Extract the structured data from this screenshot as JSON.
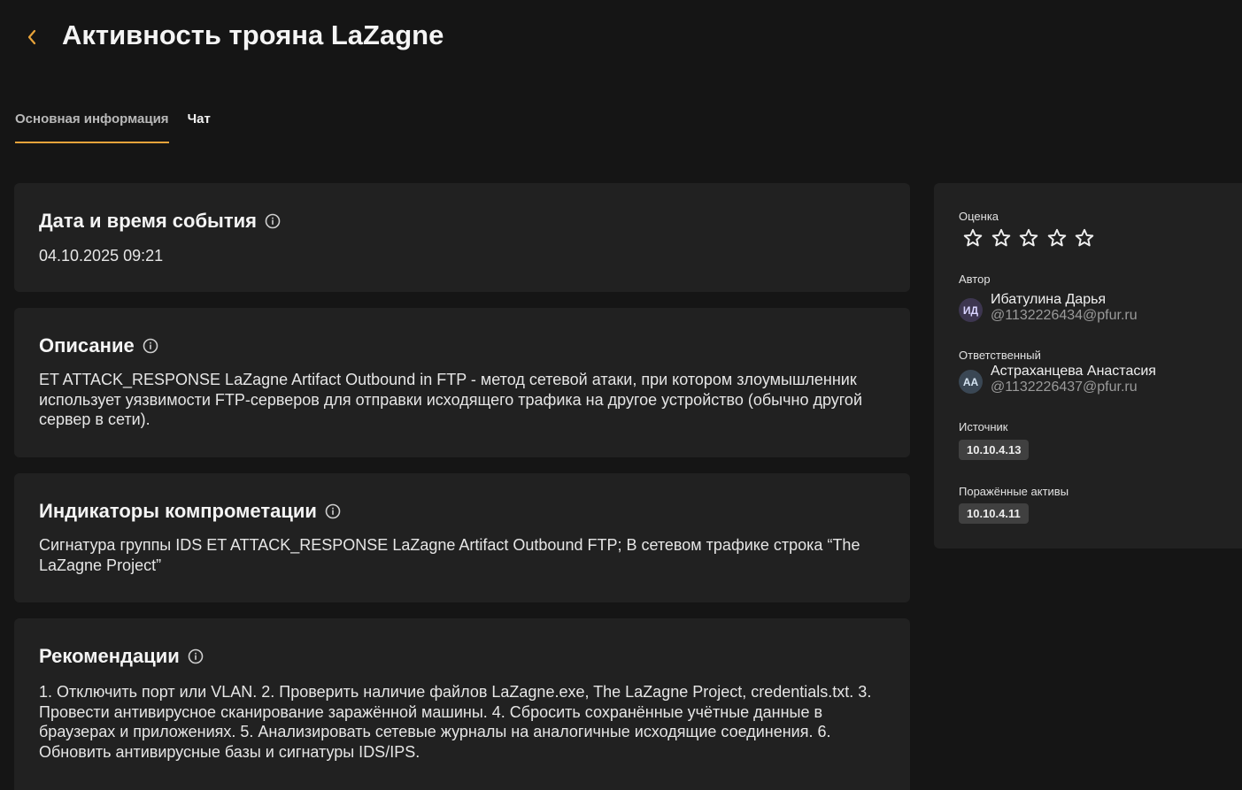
{
  "header": {
    "title": "Активность трояна LaZagne",
    "accent_color": "#e8a33a"
  },
  "tabs": [
    {
      "label": "Основная информация",
      "active": true
    },
    {
      "label": "Чат",
      "active": false
    }
  ],
  "cards": {
    "datetime": {
      "title": "Дата и время события",
      "value": "04.10.2025 09:21"
    },
    "description": {
      "title": "Описание",
      "text": "ET ATTACK_RESPONSE LaZagne Artifact Outbound in FTP - метод сетевой атаки, при котором злоумышленник использует уязвимости FTP-серверов для отправки исходящего трафика на другое устройство (обычно другой сервер в сети)."
    },
    "ioc": {
      "title": "Индикаторы компрометации",
      "text": "Сигнатура группы IDS ET ATTACK_RESPONSE LaZagne Artifact Outbound FTP; В сетевом трафике строка “The LaZagne Project”"
    },
    "recommendations": {
      "title": "Рекомендации",
      "text": "1. Отключить порт или VLAN. 2. Проверить наличие файлов LaZagne.exe, The LaZagne Project, credentials.txt. 3. Провести антивирусное сканирование заражённой машины. 4. Сбросить сохранённые учётные данные в браузерах и приложениях. 5. Анализировать сетевые журналы на аналогичные исходящие соединения. 6. Обновить антивирусные базы и сигнатуры IDS/IPS."
    }
  },
  "sidebar": {
    "rating": {
      "label": "Оценка",
      "value": 0,
      "max": 5
    },
    "author": {
      "label": "Автор",
      "initials": "ИД",
      "name": "Ибатулина Дарья",
      "email": "@1132226434@pfur.ru",
      "avatar_bg": "#3d3650",
      "avatar_fg": "#d9d4ff"
    },
    "responsible": {
      "label": "Ответственный",
      "initials": "АА",
      "name": "Астраханцева Анастасия",
      "email": "@1132226437@pfur.ru",
      "avatar_bg": "#3a4754",
      "avatar_fg": "#d5e4f2"
    },
    "source": {
      "label": "Источник",
      "value": "10.10.4.13"
    },
    "affected_assets": {
      "label": "Поражённые активы",
      "value": "10.10.4.11"
    }
  }
}
